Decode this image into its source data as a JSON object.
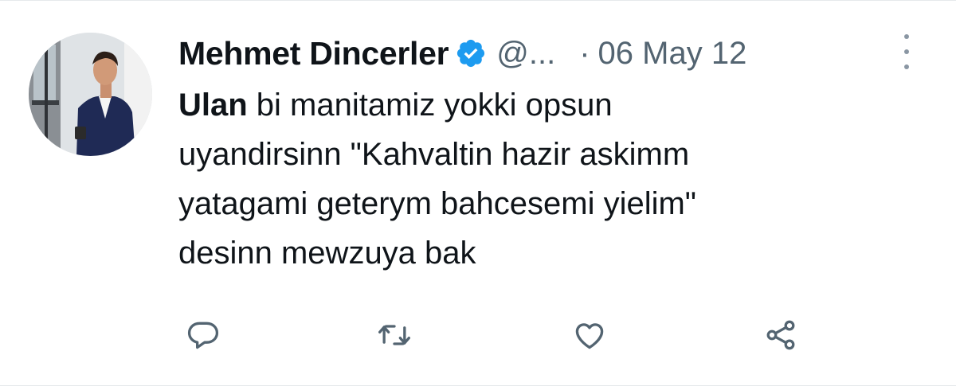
{
  "tweet": {
    "author_name": "Mehmet Dincerler",
    "handle": "@...",
    "separator": "·",
    "date": "06 May 12",
    "text_first_word": "Ulan",
    "text_line1_rest": " bi manitamiz yokki opsun",
    "text_line2": "uyandirsinn \"Kahvaltin hazir askimm",
    "text_line3": "yatagami geterym bahcesemi yielim\"",
    "text_line4": "desinn mewzuya bak"
  },
  "icons": {
    "verified": "verified-badge-icon",
    "more": "more-options-icon",
    "reply": "reply-icon",
    "retweet": "retweet-icon",
    "like": "like-icon",
    "share": "share-icon"
  },
  "colors": {
    "verified_blue": "#1d9bf0",
    "secondary_text": "#536471",
    "primary_text": "#0f1419",
    "action_icon": "#536471"
  }
}
